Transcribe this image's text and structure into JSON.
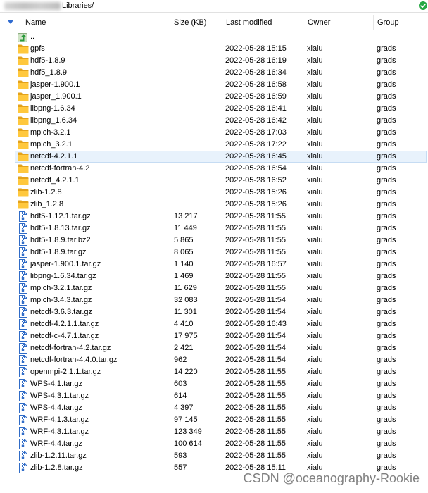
{
  "address_bar": {
    "path": "Libraries/",
    "status_icon": "check-circle-icon"
  },
  "columns": [
    {
      "key": "name",
      "label": "Name",
      "sort_icon": "sort-down-icon"
    },
    {
      "key": "size",
      "label": "Size (KB)"
    },
    {
      "key": "modified",
      "label": "Last modified"
    },
    {
      "key": "owner",
      "label": "Owner"
    },
    {
      "key": "group",
      "label": "Group"
    }
  ],
  "rows": [
    {
      "icon": "parent-directory-icon",
      "name": ".."
    },
    {
      "icon": "folder-icon",
      "name": "gpfs",
      "modified": "2022-05-28 15:15",
      "owner": "xialu",
      "group": "grads"
    },
    {
      "icon": "folder-icon",
      "name": "hdf5-1.8.9",
      "modified": "2022-05-28 16:19",
      "owner": "xialu",
      "group": "grads"
    },
    {
      "icon": "folder-icon",
      "name": "hdf5_1.8.9",
      "modified": "2022-05-28 16:34",
      "owner": "xialu",
      "group": "grads"
    },
    {
      "icon": "folder-icon",
      "name": "jasper-1.900.1",
      "modified": "2022-05-28 16:58",
      "owner": "xialu",
      "group": "grads"
    },
    {
      "icon": "folder-icon",
      "name": "jasper_1.900.1",
      "modified": "2022-05-28 16:59",
      "owner": "xialu",
      "group": "grads"
    },
    {
      "icon": "folder-icon",
      "name": "libpng-1.6.34",
      "modified": "2022-05-28 16:41",
      "owner": "xialu",
      "group": "grads"
    },
    {
      "icon": "folder-icon",
      "name": "libpng_1.6.34",
      "modified": "2022-05-28 16:42",
      "owner": "xialu",
      "group": "grads"
    },
    {
      "icon": "folder-icon",
      "name": "mpich-3.2.1",
      "modified": "2022-05-28 17:03",
      "owner": "xialu",
      "group": "grads"
    },
    {
      "icon": "folder-icon",
      "name": "mpich_3.2.1",
      "modified": "2022-05-28 17:22",
      "owner": "xialu",
      "group": "grads"
    },
    {
      "icon": "folder-icon",
      "name": "netcdf-4.2.1.1",
      "modified": "2022-05-28 16:45",
      "owner": "xialu",
      "group": "grads",
      "selected": true
    },
    {
      "icon": "folder-icon",
      "name": "netcdf-fortran-4.2",
      "modified": "2022-05-28 16:54",
      "owner": "xialu",
      "group": "grads"
    },
    {
      "icon": "folder-icon",
      "name": "netcdf_4.2.1.1",
      "modified": "2022-05-28 16:52",
      "owner": "xialu",
      "group": "grads"
    },
    {
      "icon": "folder-icon",
      "name": "zlib-1.2.8",
      "modified": "2022-05-28 15:26",
      "owner": "xialu",
      "group": "grads"
    },
    {
      "icon": "folder-icon",
      "name": "zlib_1.2.8",
      "modified": "2022-05-28 15:26",
      "owner": "xialu",
      "group": "grads"
    },
    {
      "icon": "archive-file-icon",
      "name": "hdf5-1.12.1.tar.gz",
      "size": "13 217",
      "modified": "2022-05-28 11:55",
      "owner": "xialu",
      "group": "grads"
    },
    {
      "icon": "archive-file-icon",
      "name": "hdf5-1.8.13.tar.gz",
      "size": "11 449",
      "modified": "2022-05-28 11:55",
      "owner": "xialu",
      "group": "grads"
    },
    {
      "icon": "archive-file-icon",
      "name": "hdf5-1.8.9.tar.bz2",
      "size": "5 865",
      "modified": "2022-05-28 11:55",
      "owner": "xialu",
      "group": "grads"
    },
    {
      "icon": "archive-file-icon",
      "name": "hdf5-1.8.9.tar.gz",
      "size": "8 065",
      "modified": "2022-05-28 11:55",
      "owner": "xialu",
      "group": "grads"
    },
    {
      "icon": "archive-file-icon",
      "name": "jasper-1.900.1.tar.gz",
      "size": "1 140",
      "modified": "2022-05-28 16:57",
      "owner": "xialu",
      "group": "grads"
    },
    {
      "icon": "archive-file-icon",
      "name": "libpng-1.6.34.tar.gz",
      "size": "1 469",
      "modified": "2022-05-28 11:55",
      "owner": "xialu",
      "group": "grads"
    },
    {
      "icon": "archive-file-icon",
      "name": "mpich-3.2.1.tar.gz",
      "size": "11 629",
      "modified": "2022-05-28 11:55",
      "owner": "xialu",
      "group": "grads"
    },
    {
      "icon": "archive-file-icon",
      "name": "mpich-3.4.3.tar.gz",
      "size": "32 083",
      "modified": "2022-05-28 11:54",
      "owner": "xialu",
      "group": "grads"
    },
    {
      "icon": "archive-file-icon",
      "name": "netcdf-3.6.3.tar.gz",
      "size": "11 301",
      "modified": "2022-05-28 11:54",
      "owner": "xialu",
      "group": "grads"
    },
    {
      "icon": "archive-file-icon",
      "name": "netcdf-4.2.1.1.tar.gz",
      "size": "4 410",
      "modified": "2022-05-28 16:43",
      "owner": "xialu",
      "group": "grads"
    },
    {
      "icon": "archive-file-icon",
      "name": "netcdf-c-4.7.1.tar.gz",
      "size": "17 975",
      "modified": "2022-05-28 11:54",
      "owner": "xialu",
      "group": "grads"
    },
    {
      "icon": "archive-file-icon",
      "name": "netcdf-fortran-4.2.tar.gz",
      "size": "2 421",
      "modified": "2022-05-28 11:54",
      "owner": "xialu",
      "group": "grads"
    },
    {
      "icon": "archive-file-icon",
      "name": "netcdf-fortran-4.4.0.tar.gz",
      "size": "962",
      "modified": "2022-05-28 11:54",
      "owner": "xialu",
      "group": "grads"
    },
    {
      "icon": "archive-file-icon",
      "name": "openmpi-2.1.1.tar.gz",
      "size": "14 220",
      "modified": "2022-05-28 11:55",
      "owner": "xialu",
      "group": "grads"
    },
    {
      "icon": "archive-file-icon",
      "name": "WPS-4.1.tar.gz",
      "size": "603",
      "modified": "2022-05-28 11:55",
      "owner": "xialu",
      "group": "grads"
    },
    {
      "icon": "archive-file-icon",
      "name": "WPS-4.3.1.tar.gz",
      "size": "614",
      "modified": "2022-05-28 11:55",
      "owner": "xialu",
      "group": "grads"
    },
    {
      "icon": "archive-file-icon",
      "name": "WPS-4.4.tar.gz",
      "size": "4 397",
      "modified": "2022-05-28 11:55",
      "owner": "xialu",
      "group": "grads"
    },
    {
      "icon": "archive-file-icon",
      "name": "WRF-4.1.3.tar.gz",
      "size": "97 145",
      "modified": "2022-05-28 11:55",
      "owner": "xialu",
      "group": "grads"
    },
    {
      "icon": "archive-file-icon",
      "name": "WRF-4.3.1.tar.gz",
      "size": "123 349",
      "modified": "2022-05-28 11:55",
      "owner": "xialu",
      "group": "grads"
    },
    {
      "icon": "archive-file-icon",
      "name": "WRF-4.4.tar.gz",
      "size": "100 614",
      "modified": "2022-05-28 11:55",
      "owner": "xialu",
      "group": "grads"
    },
    {
      "icon": "archive-file-icon",
      "name": "zlib-1.2.11.tar.gz",
      "size": "593",
      "modified": "2022-05-28 11:55",
      "owner": "xialu",
      "group": "grads"
    },
    {
      "icon": "archive-file-icon",
      "name": "zlib-1.2.8.tar.gz",
      "size": "557",
      "modified": "2022-05-28 15:11",
      "owner": "xialu",
      "group": "grads"
    }
  ],
  "watermark": "CSDN @oceanography-Rookie",
  "colors": {
    "folder": "#ffc83d",
    "folder_tab": "#e3a21a",
    "archive": "#2f6bc7",
    "sort_arrow": "#2f6bd0",
    "status_ok": "#27a844",
    "selection": "#e8f2fc",
    "selection_border": "#c6dcf3",
    "watermark": "#6a6a6a"
  }
}
